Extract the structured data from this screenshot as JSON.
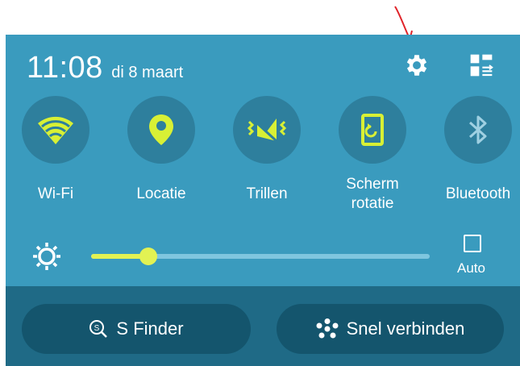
{
  "status": {
    "time": "11:08",
    "date": "di 8 maart"
  },
  "header_icons": [
    "gear-icon",
    "grid-edit-icon"
  ],
  "quick_settings": [
    {
      "id": "wifi",
      "label": "Wi-Fi",
      "icon": "wifi-icon",
      "active": true
    },
    {
      "id": "location",
      "label": "Locatie",
      "icon": "location-pin-icon",
      "active": true
    },
    {
      "id": "vibrate",
      "label": "Trillen",
      "icon": "vibrate-icon",
      "active": true
    },
    {
      "id": "rotate",
      "label_line1": "Scherm",
      "label_line2": "rotatie",
      "icon": "screen-rotation-icon",
      "active": true
    },
    {
      "id": "bluetooth",
      "label": "Bluetooth",
      "icon": "bluetooth-icon",
      "active": false
    }
  ],
  "brightness": {
    "level": 0.17,
    "auto_label": "Auto",
    "auto_checked": false
  },
  "bottom_buttons": {
    "s_finder": "S Finder",
    "quick_connect": "Snel verbinden"
  },
  "colors": {
    "panel": "#3a9bbe",
    "circle": "#2e7f9d",
    "active_icon": "#d8f035",
    "inactive_icon": "#9fd0e2",
    "bottom_bar": "#1f6a86",
    "pill": "#14556d",
    "annotation_arrow": "#e0242a"
  }
}
